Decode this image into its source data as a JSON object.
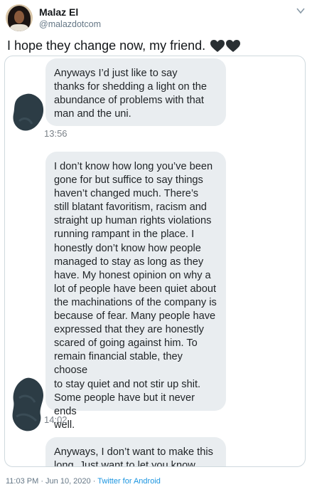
{
  "author": {
    "display_name": "Malaz El",
    "handle": "@malazdotcom"
  },
  "tweet": {
    "text": "I hope they change now, my friend.",
    "emojis": [
      "black-heart-icon",
      "black-heart-icon"
    ]
  },
  "messages": [
    {
      "text": "Anyways I’d just like to say\nthanks for shedding a light on the\nabundance of problems with that\nman and the uni.",
      "time": "13:56"
    },
    {
      "text": "I don’t know how long you’ve been\ngone for but suffice to say things\nhaven’t changed much. There’s\nstill blatant favoritism, racism and\nstraight up human rights violations\nrunning rampant in the place. I\nhonestly don’t know how people\nmanaged to stay as long as they\nhave. My honest opinion on why a\nlot of people have been quiet about\nthe machinations of the company is\nbecause of fear. Many people have\nexpressed that they are honestly\nscared of going against him. To\nremain financial stable, they choose\nto stay quiet and not stir up shit.\nSome people have but it never ends\nwell.",
      "time": "14:02"
    },
    {
      "text": "Anyways, I don’t want to make this\nlong. Just want to let you know",
      "time": ""
    }
  ],
  "meta": {
    "timestamp": "11:03 PM · Jun 10, 2020 · ",
    "source": "Twitter for Android"
  },
  "colors": {
    "bubble": "#e9edf0",
    "link": "#1b95e0",
    "scribble": "#2c3c45"
  }
}
